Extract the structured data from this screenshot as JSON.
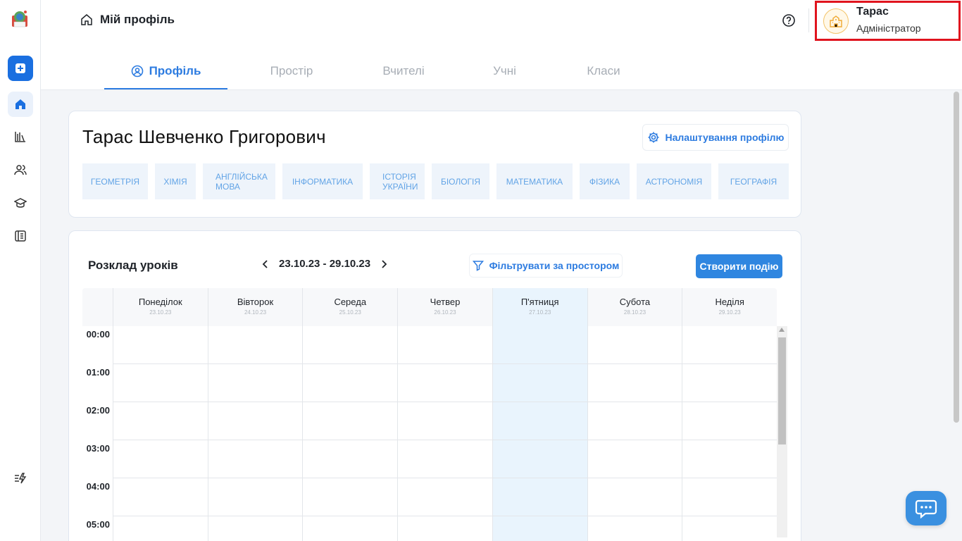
{
  "header": {
    "breadcrumb": "Мій профіль",
    "user_name": "Тарас",
    "user_role": "Адміністратор"
  },
  "tabs": [
    {
      "label": "Профіль",
      "active": true
    },
    {
      "label": "Простір",
      "active": false
    },
    {
      "label": "Вчителі",
      "active": false
    },
    {
      "label": "Учні",
      "active": false
    },
    {
      "label": "Класи",
      "active": false
    }
  ],
  "profile": {
    "full_name": "Тарас Шевченко Григорович",
    "settings_label": "Налаштування профілю",
    "subjects": [
      "ГЕОМЕТРІЯ",
      "ХІМІЯ",
      "АНГЛІЙСЬКА МОВА",
      "ІНФОРМАТИКА",
      "ІСТОРІЯ УКРАЇНИ",
      "БІОЛОГІЯ",
      "МАТЕМАТИКА",
      "ФІЗИКА",
      "АСТРОНОМІЯ",
      "ГЕОГРАФІЯ"
    ]
  },
  "schedule": {
    "title": "Розклад уроків",
    "week_range": "23.10.23 - 29.10.23",
    "filter_label": "Фільтрувати за простором",
    "create_label": "Створити подію",
    "days": [
      {
        "name": "Понеділок",
        "date": "23.10.23"
      },
      {
        "name": "Вівторок",
        "date": "24.10.23"
      },
      {
        "name": "Середа",
        "date": "25.10.23"
      },
      {
        "name": "Четвер",
        "date": "26.10.23"
      },
      {
        "name": "П'ятниця",
        "date": "27.10.23"
      },
      {
        "name": "Субота",
        "date": "28.10.23"
      },
      {
        "name": "Неділя",
        "date": "29.10.23"
      }
    ],
    "today_index": 4,
    "hours": [
      "00:00",
      "01:00",
      "02:00",
      "03:00",
      "04:00",
      "05:00"
    ]
  },
  "colors": {
    "accent": "#2c7be0",
    "highlight_border": "#e0141e",
    "today_bg": "#e9f4fd"
  },
  "icons": {
    "sidebar": [
      "add-icon",
      "home-icon",
      "library-icon",
      "users-icon",
      "graduation-cap-icon",
      "journal-icon",
      "flash-list-icon"
    ],
    "chat": "chat-icon"
  }
}
